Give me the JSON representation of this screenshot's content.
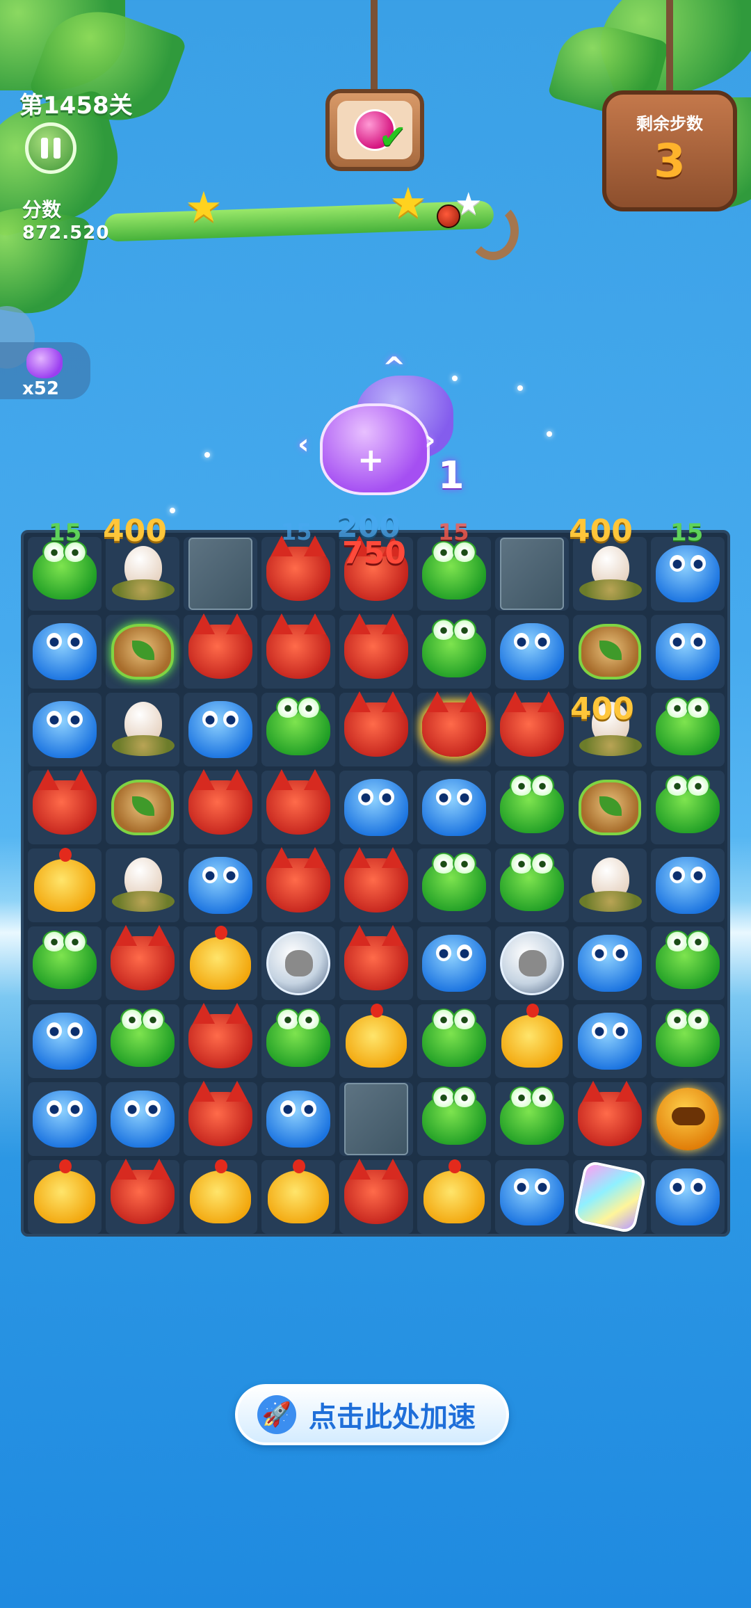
{
  "hud": {
    "level_label": "第1458关",
    "score_label": "分数",
    "score_value": "872.520",
    "moves_label": "剩余步数",
    "moves_value": "3",
    "stars_earned": 2,
    "stars_total": 3,
    "goal_icon": "pink-gem-icon",
    "goal_complete": true
  },
  "booster": {
    "icon": "purple-bear-icon",
    "count": "x52"
  },
  "effect": {
    "icon": "purple-bear-plus-icon",
    "value": "1"
  },
  "score_popups": [
    "15",
    "400",
    "15",
    "200",
    "15",
    "750",
    "400",
    "15",
    "400"
  ],
  "board": {
    "cols": 9,
    "rows": 9,
    "grid": [
      [
        "frog",
        "egg",
        "empty",
        "fox",
        "fox",
        "frog",
        "empty",
        "egg",
        "bear"
      ],
      [
        "bear",
        "leaf-glow",
        "fox",
        "fox",
        "fox",
        "frog",
        "bear",
        "leaf",
        "bear"
      ],
      [
        "bear",
        "egg",
        "bear",
        "frog",
        "fox",
        "fox-glow",
        "fox",
        "egg",
        "frog"
      ],
      [
        "fox",
        "leaf",
        "fox",
        "fox",
        "bear",
        "bear",
        "frog",
        "leaf",
        "frog"
      ],
      [
        "chick",
        "egg-cracked",
        "bear",
        "fox",
        "fox",
        "frog",
        "frog",
        "egg-cracked",
        "bear"
      ],
      [
        "frog",
        "fox",
        "chick",
        "skull",
        "fox",
        "bear",
        "skull",
        "bear",
        "frog"
      ],
      [
        "bear",
        "frog",
        "fox",
        "frog",
        "chick",
        "frog",
        "chick",
        "bear",
        "frog"
      ],
      [
        "bear",
        "bear",
        "fox",
        "bear",
        "empty",
        "frog",
        "frog",
        "fox",
        "robot"
      ],
      [
        "chick",
        "fox",
        "chick",
        "chick",
        "fox",
        "chick",
        "bear",
        "star",
        "bear"
      ]
    ]
  },
  "speedup_button": {
    "label": "点击此处加速",
    "icon": "rocket-icon"
  },
  "colors": {
    "frog": "#2ea82a",
    "fox": "#d72a20",
    "bear": "#1a73e0",
    "chick": "#f2b20f"
  }
}
